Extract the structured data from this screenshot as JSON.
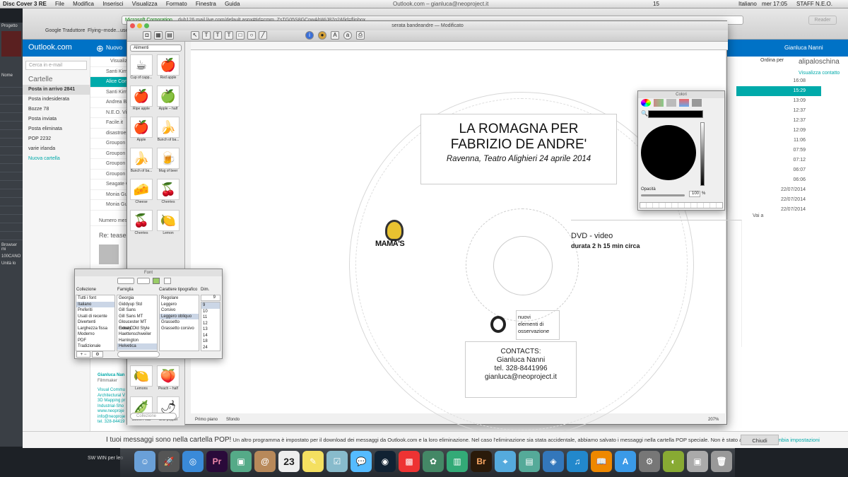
{
  "menubar": {
    "app": "Disc Cover 3 RE",
    "items": [
      "File",
      "Modifica",
      "Inserisci",
      "Visualizza",
      "Formato",
      "Finestra",
      "Guida"
    ],
    "center": "Outlook.com – gianluca@neoproject.it",
    "right": [
      "15",
      "Italiano",
      "mer 17:05",
      "STAFF N.E.O."
    ]
  },
  "browser": {
    "url_host": "Microsoft Corporation",
    "url": "dub126.mail.live.com/default.aspx#tid=cmm_ZsTG05S8GCnwAhWjJ87g2&fid=flinbox",
    "bookmarks": [
      "Google Traduttore",
      "Flying~mode...use 3"
    ],
    "reader": "Reader"
  },
  "outlook": {
    "brand": "Outlook.com",
    "new": "Nuovo",
    "search_placeholder": "Cerca in e-mail",
    "folders_title": "Cartelle",
    "folders": [
      {
        "label": "Posta in arrivo",
        "count": "2841"
      },
      {
        "label": "Posta indesiderata",
        "count": ""
      },
      {
        "label": "Bozze",
        "count": "78"
      },
      {
        "label": "Posta inviata",
        "count": ""
      },
      {
        "label": "Posta eliminata",
        "count": ""
      },
      {
        "label": "POP",
        "count": "2232"
      },
      {
        "label": "varie irlanda",
        "count": ""
      },
      {
        "label": "Nuova cartella",
        "count": ""
      }
    ],
    "view_label": "Visualizza: Tu",
    "senders": [
      "Santi Kim",
      "Alice Conti",
      "Santi Kim",
      "Andrea Ber",
      "N.E.O. Visu",
      "Facile.it",
      "disastroesi",
      "Groupon S",
      "Groupon S",
      "Groupon",
      "Groupon",
      "Seagate Gl",
      "Monia Gua",
      "Monia Gua"
    ],
    "times": [
      "16:08",
      "15:29",
      "13:09",
      "12:37",
      "12:37",
      "12:09",
      "11:06",
      "07:59",
      "07:12",
      "06:07",
      "06:06",
      "22/07/2014",
      "22/07/2014",
      "22/07/2014"
    ],
    "sort": "Ordina per",
    "user": "Gianluca Nanni",
    "contact_name": "alipaloschina",
    "contact_link": "Visualizza contatto",
    "page_nav": "Vai a",
    "reading_subject": "Re: teaser",
    "signature": [
      "Gianluca Nan",
      "Filmmaker",
      "Visual Commu",
      "Architectural V",
      "3D Mapping pr",
      "Industrial-Sho",
      "www.neoproje",
      "info@neoproje",
      "tel. 328-84419"
    ],
    "count_label": "Numero messagi"
  },
  "discwin": {
    "title": "serata bandeandre — Modificato",
    "category": "Alimenti",
    "clips": [
      "Cup of capp...",
      "Red apple",
      "Ripe apple",
      "Apple – half",
      "Apple",
      "Bunch of ba...",
      "Bunch of ba...",
      "Mug of beer",
      "Cheese",
      "Cherries",
      "Cherries",
      "Lemon",
      "Lemons",
      "Peach – half",
      "Sweet Peas",
      "Chili pepper"
    ],
    "collection_placeholder": "Collezione",
    "tabs": [
      "Primo piano",
      "Sfondo"
    ],
    "zoom": "207%"
  },
  "cover": {
    "title1": "LA ROMAGNA PER",
    "title2": "FABRIZIO DE ANDRE'",
    "subtitle": "Ravenna, Teatro Alighieri 24 aprile 2014",
    "dvd": "DVD - video",
    "duration": "durata 2 h 15 min circa",
    "logo_mamas": "MAMA'S",
    "neo": [
      "nuovi",
      "elementi di",
      "osservazione"
    ],
    "contacts": [
      "CONTACTS:",
      "Gianluca Nanni",
      "tel. 328-8441996",
      "gianluca@neoproject.it"
    ]
  },
  "fontpanel": {
    "title": "Font",
    "headers": [
      "Collezione",
      "Famiglia",
      "Carattere tipografico",
      "Dim."
    ],
    "collections": [
      "Tutti i font",
      "Italiano",
      "Preferiti",
      "Usati di recente",
      "Divertenti",
      "Larghezza fissa",
      "Moderno",
      "PDF",
      "Tradizionale"
    ],
    "families": [
      "Georgia",
      "Giddyup Std",
      "Gill Sans",
      "Gill Sans MT",
      "Gloucester MT Extra C",
      "Goudy Old Style",
      "Haettenschweiler",
      "Harrington",
      "Helvetica"
    ],
    "styles": [
      "Regolare",
      "Leggero",
      "Corsivo",
      "Leggero obliquo",
      "Grassetto",
      "Grassetto corsivo"
    ],
    "size": "9",
    "sizes": [
      "9",
      "10",
      "11",
      "12",
      "13",
      "14",
      "18",
      "24"
    ]
  },
  "colorpanel": {
    "title": "Colori",
    "opacity_label": "Opacità",
    "opacity_value": "100",
    "unit": "%"
  },
  "notif": {
    "text": "I tuoi messaggi sono nella cartella POP!",
    "detail": "Un altro programma è impostato per il download dei messaggi da Outlook.com e la loro eliminazione. Nel caso l'eliminazione sia stata accidentale, abbiamo salvato i messaggi nella cartella POP speciale. Non è stato accidentale?",
    "link": "Cambia impostazioni",
    "close": "Chiudi"
  },
  "side": {
    "project_label": "Progetto",
    "browser_label": "Browser mi",
    "drive_label": "100CANO",
    "units": "Unità lo",
    "name_col": "Nome",
    "elem": "Elem"
  },
  "dock": {
    "label": "SW WIN per leo",
    "calendar_day": "23"
  }
}
